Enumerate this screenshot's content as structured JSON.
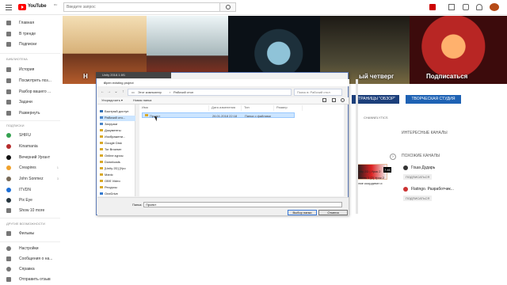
{
  "header": {
    "logo_text": "YouTube",
    "logo_region": "RU",
    "search_placeholder": "Введите запрос"
  },
  "sidebar": {
    "items": [
      {
        "label": "Главная",
        "icon": "home-icon"
      },
      {
        "label": "В тренде",
        "icon": "trending-icon"
      },
      {
        "label": "Подписки",
        "icon": "subscriptions-icon"
      },
      {
        "label": "История",
        "icon": "history-icon"
      },
      {
        "label": "Посмотреть поз...",
        "icon": "watch-later-icon"
      },
      {
        "label": "Разбор вашего ...",
        "icon": "playlist-icon"
      },
      {
        "label": "Задачи",
        "icon": "tasks-icon"
      },
      {
        "label": "Развернуть",
        "icon": "expand-icon"
      }
    ],
    "library_heading": "БИБЛИОТЕКА",
    "subscriptions_heading": "ПОДПИСКИ",
    "subscriptions": [
      {
        "label": "SHIFU",
        "count": ""
      },
      {
        "label": "Kinamania",
        "count": ""
      },
      {
        "label": "Вечерний Ургант",
        "count": ""
      },
      {
        "label": "Creapires",
        "count": "1"
      },
      {
        "label": "John Sonmez",
        "count": "3"
      },
      {
        "label": "ITVDN",
        "count": ""
      },
      {
        "label": "Pix Eye",
        "count": ""
      },
      {
        "label": "Show 10 more",
        "count": ""
      }
    ],
    "other_heading": "ДРУГИЕ ВОЗМОЖНОСТИ",
    "other": [
      {
        "label": "Фильмы",
        "icon": "movies-icon"
      },
      {
        "label": "Настройки",
        "icon": "settings-icon"
      },
      {
        "label": "Сообщения о на...",
        "icon": "flag-icon"
      },
      {
        "label": "Справка",
        "icon": "help-icon"
      },
      {
        "label": "Отправить отзыв",
        "icon": "feedback-icon"
      }
    ]
  },
  "banner": {
    "left_label": "Н",
    "right_label": "Подписаться",
    "middle_label": "ый четверг"
  },
  "channel": {
    "button_1": "СТРАНИЦЫ \"ОБЗОР\"",
    "button_2": "ТВОРЧЕСКАЯ СТУДИЯ",
    "link": "CHANNELYTICS",
    "interesting_heading": "ИНТЕРЕСНЫЕ КАНАЛЫ",
    "similar_heading": "ПОХОЖИЕ КАНАЛЫ",
    "similar": [
      {
        "name": "Гоша Дударь",
        "button": "ПОДПИСАТЬСЯ"
      },
      {
        "name": "Flatingo. Разработчик...",
        "button": "ПОДПИСАТЬСЯ"
      }
    ],
    "mini_text_1": "Unity 2D | Урок 2",
    "mini_text_2": "ровень 1 [2] Урок 2",
    "mini_text_3": "ение координат и",
    "mini_time": "7:45"
  },
  "dialog": {
    "strip": "Unity 2018.1.6f1",
    "title": "Open existing project",
    "close": "×",
    "path_part_1": "Этот компьютер",
    "path_part_2": "Рабочий стол",
    "search_placeholder": "Поиск в: Рабочий стол",
    "toolbar_sort": "Упорядочить ▾",
    "toolbar_new_folder": "Новая папка",
    "nav_items": [
      {
        "label": "Быстрый доступ",
        "icon": "quick-access-icon"
      },
      {
        "label": "Рабочий сто...",
        "icon": "desktop-folder-icon"
      },
      {
        "label": "Загрузки",
        "icon": "downloads-folder-icon"
      },
      {
        "label": "Документы",
        "icon": "documents-folder-icon"
      },
      {
        "label": "Изображени...",
        "icon": "pictures-folder-icon"
      },
      {
        "label": "Google Disk",
        "icon": "google-disk-folder-icon"
      },
      {
        "label": "Tor Browser",
        "icon": "tor-folder-icon"
      },
      {
        "label": "Online курсы",
        "icon": "courses-folder-icon"
      },
      {
        "label": "Downloads",
        "icon": "folder-icon"
      },
      {
        "label": "[Unity 2D] [Уро",
        "icon": "folder-icon"
      },
      {
        "label": "Manic",
        "icon": "folder-icon"
      },
      {
        "label": "OBS Video",
        "icon": "folder-icon"
      },
      {
        "label": "Ресурсы",
        "icon": "folder-icon"
      },
      {
        "label": "OneDrive",
        "icon": "onedrive-icon"
      }
    ],
    "columns": [
      "Имя",
      "Дата изменения",
      "Тип",
      "Размер"
    ],
    "file": {
      "name": "Проект",
      "date": "26.01.2018 22:18",
      "type": "Папка с файлами",
      "size": ""
    },
    "folder_label": "Папка:",
    "folder_value": "Проект",
    "select_button": "Выбор папки",
    "cancel_button": "Отмена"
  }
}
